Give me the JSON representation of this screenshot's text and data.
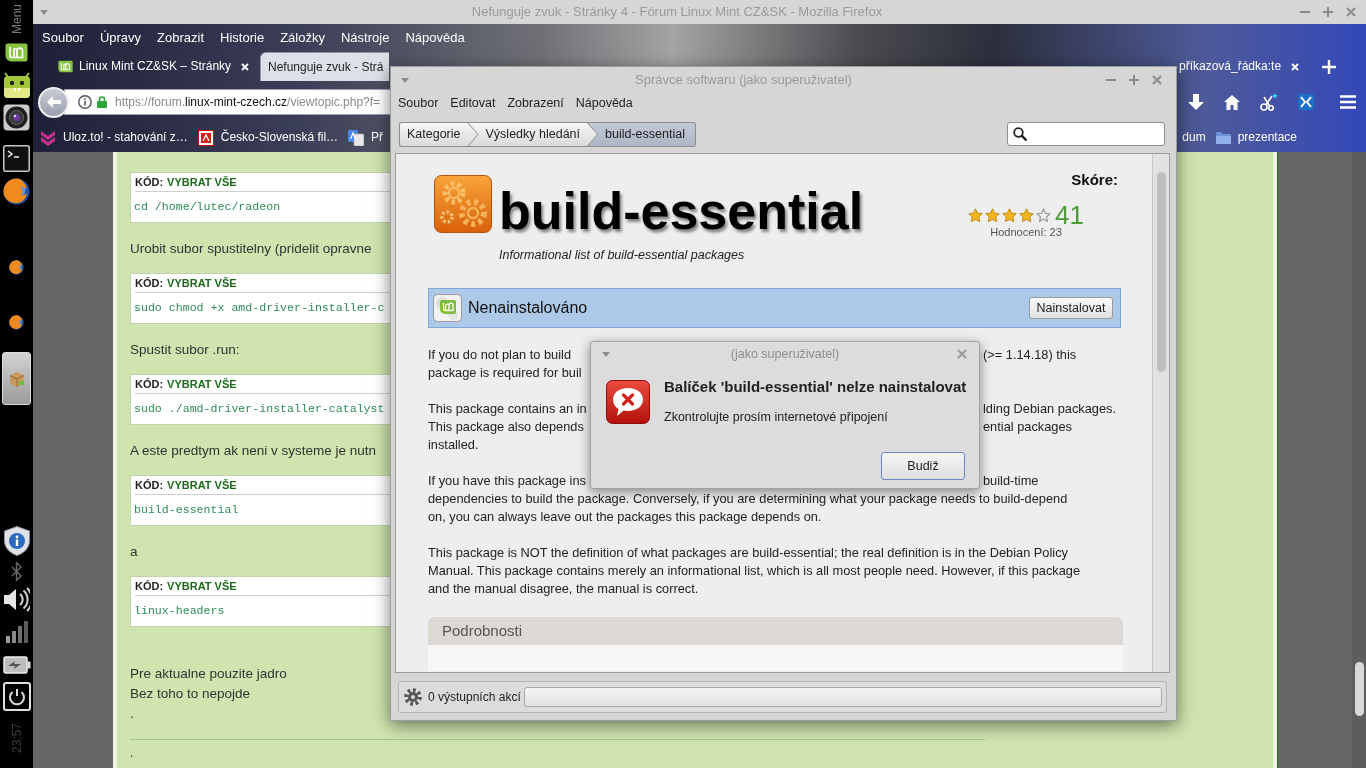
{
  "panel": {
    "menu_label": "Menu",
    "launchers": [
      {
        "kind": "mint",
        "selected": false
      },
      {
        "kind": "android",
        "selected": false
      },
      {
        "kind": "camera",
        "selected": false
      },
      {
        "kind": "terminal",
        "selected": false
      },
      {
        "kind": "firefox",
        "selected": false
      },
      {
        "kind": "firefox_small",
        "selected": false
      },
      {
        "kind": "firefox_small",
        "selected": false
      },
      {
        "kind": "package",
        "selected": true
      }
    ],
    "tray": [
      {
        "kind": "shield"
      },
      {
        "kind": "bluetooth"
      },
      {
        "kind": "volume"
      },
      {
        "kind": "signal"
      },
      {
        "kind": "battery"
      },
      {
        "kind": "power"
      }
    ],
    "clock": "23:57"
  },
  "firefox": {
    "title": "Nefunguje zvuk - Stránky 4 - Fórum Linux Mint CZ&SK - Mozilla Firefox",
    "menu": [
      "Soubor",
      "Úpravy",
      "Zobrazit",
      "Historie",
      "Záložky",
      "Nástroje",
      "Nápověda"
    ],
    "tabs_left": [
      {
        "favicon": true,
        "label": "Linux Mint CZ&SK – Stránky",
        "close": true,
        "selected": false
      },
      {
        "label": "Nefunguje zvuk - Strá",
        "selected": true
      }
    ],
    "tabs_right": [
      {
        "label": "příkazová_řádka:te",
        "close": true,
        "selected": false
      }
    ],
    "url": {
      "prefix": "https://forum.",
      "domain": "linux-mint-czech.cz",
      "path": "/viewtopic.php?f="
    },
    "bookmarks_left": [
      {
        "kind": "chevrons",
        "label": "Uloz.to! - stahování z…"
      },
      {
        "kind": "film",
        "label": "Česko-Slovenská fil…"
      },
      {
        "kind": "translate",
        "label": "Př"
      }
    ],
    "bookmarks_right": [
      {
        "kind": "plain",
        "label": "dum"
      },
      {
        "kind": "folder",
        "label": "prezentace"
      }
    ]
  },
  "forum": {
    "blocks": [
      {
        "kind": "code",
        "label": "KÓD:",
        "action": "VYBRAT VŠE",
        "code": "cd /home/lutec/radeon"
      },
      {
        "kind": "text",
        "text": "Urobit subor spustitelny (pridelit opravne"
      },
      {
        "kind": "code",
        "label": "KÓD:",
        "action": "VYBRAT VŠE",
        "code": "sudo chmod +x amd-driver-installer-c"
      },
      {
        "kind": "text",
        "text": "Spustit subor .run:"
      },
      {
        "kind": "code",
        "label": "KÓD:",
        "action": "VYBRAT VŠE",
        "code": "sudo ./amd-driver-installer-catalyst"
      },
      {
        "kind": "text",
        "text": "A este predtym ak neni v systeme je nutn"
      },
      {
        "kind": "code",
        "label": "KÓD:",
        "action": "VYBRAT VŠE",
        "code": "build-essential"
      },
      {
        "kind": "text",
        "text": "a"
      },
      {
        "kind": "code",
        "label": "KÓD:",
        "action": "VYBRAT VŠE",
        "code": "linux-headers"
      },
      {
        "kind": "paragraph",
        "lines": [
          "Pre aktualne pouzite jadro",
          "Bez toho to nepojde",
          "."
        ]
      }
    ],
    "signature": "."
  },
  "software_manager": {
    "title": "Správce softwaru (jako superuživatel)",
    "menu": [
      "Soubor",
      "Editovat",
      "Zobrazení",
      "Nápověda"
    ],
    "breadcrumbs": [
      {
        "label": "Kategorie",
        "selected": false
      },
      {
        "label": "Výsledky hledání",
        "selected": false
      },
      {
        "label": "build-essential",
        "selected": true
      }
    ],
    "package": {
      "name": "build-essential",
      "summary": "Informational list of build-essential packages",
      "score_label": "Skóre:",
      "stars": 4,
      "score": "41",
      "reviews": "Hodnocení: 23",
      "status": "Nenainstalováno",
      "action": "Nainstalovat"
    },
    "description": [
      {
        "lines": [
          {
            "text": "If you do not plan to build",
            "after_dialog": "(>= 1.14.18) this"
          },
          {
            "text": "package is required for buil"
          }
        ]
      },
      {
        "lines": [
          {
            "text": "This package contains an in",
            "after_dialog": "lding Debian packages."
          },
          {
            "text": "This package also depends",
            "after_dialog": "ential packages"
          },
          {
            "text": "installed."
          }
        ]
      },
      {
        "lines": [
          {
            "text": "If you have this package ins",
            "after_dialog": "build-time"
          },
          {
            "text": "dependencies to build the package. Conversely, if you are determining what your package needs to build-depend"
          },
          {
            "text": "on, you can always leave out the packages this package depends on."
          }
        ]
      },
      {
        "lines": [
          {
            "text": "This package is NOT the definition of what packages are build-essential; the real definition is in the Debian Policy"
          },
          {
            "text": "Manual. This package contains merely an informational list, which is all most people need. However, if this package"
          },
          {
            "text": "and the manual disagree, the manual is correct."
          }
        ]
      }
    ],
    "details_heading": "Podrobnosti",
    "actions_status": "0 výstupních akcí"
  },
  "dialog": {
    "title": "(jako superuživatel)",
    "heading": "Balíček 'build-essential' nelze nainstalovat",
    "message": "Zkontrolujte prosím internetové připojení",
    "button": "Budiž"
  }
}
